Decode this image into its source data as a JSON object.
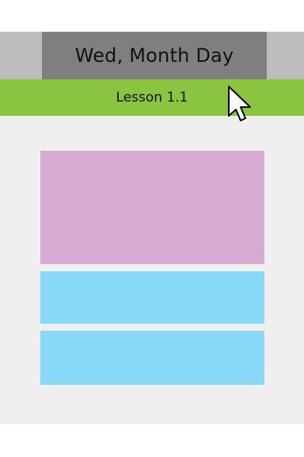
{
  "header": {
    "date_label": "Wed, Month Day"
  },
  "lesson_bar": {
    "label": "Lesson 1.1"
  },
  "colors": {
    "background": "#efefef",
    "header_side": "#bdbdbd",
    "header_center": "#7f7f7f",
    "lesson_bar": "#8bc53f",
    "primary_card": "#d6aad2",
    "secondary_card": "#8ad8f7"
  },
  "cursor": {
    "icon": "mouse-pointer-icon"
  }
}
